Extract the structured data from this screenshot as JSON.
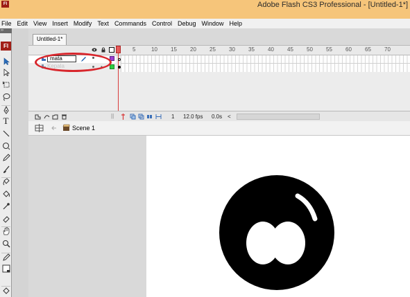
{
  "window": {
    "app_icon_label": "Fl",
    "title": "Adobe Flash CS3 Professional - [Untitled-1*]"
  },
  "menu": {
    "items": [
      "File",
      "Edit",
      "View",
      "Insert",
      "Modify",
      "Text",
      "Commands",
      "Control",
      "Debug",
      "Window",
      "Help"
    ]
  },
  "tools": {
    "logo": "Fl",
    "grip": "››"
  },
  "document": {
    "tab_label": "Untitled-1*"
  },
  "timeline": {
    "frame_numbers": [
      "5",
      "10",
      "15",
      "20",
      "25",
      "30",
      "35",
      "40",
      "45",
      "50",
      "55",
      "60",
      "65",
      "70"
    ],
    "layers": [
      {
        "name": "mata",
        "selected": true,
        "color": "#9b3fd1"
      },
      {
        "name": "Kepala",
        "selected": false,
        "color": "#2ecc40"
      }
    ],
    "footer": {
      "current_frame": "1",
      "frame_rate": "12.0 fps",
      "elapsed": "0.0s",
      "scroll_left": "<"
    }
  },
  "editbar": {
    "scene_label": "Scene 1"
  },
  "colors": {
    "titlebar": "#f6c57a",
    "annotation": "#d8262c",
    "playhead": "#d83a3a"
  }
}
